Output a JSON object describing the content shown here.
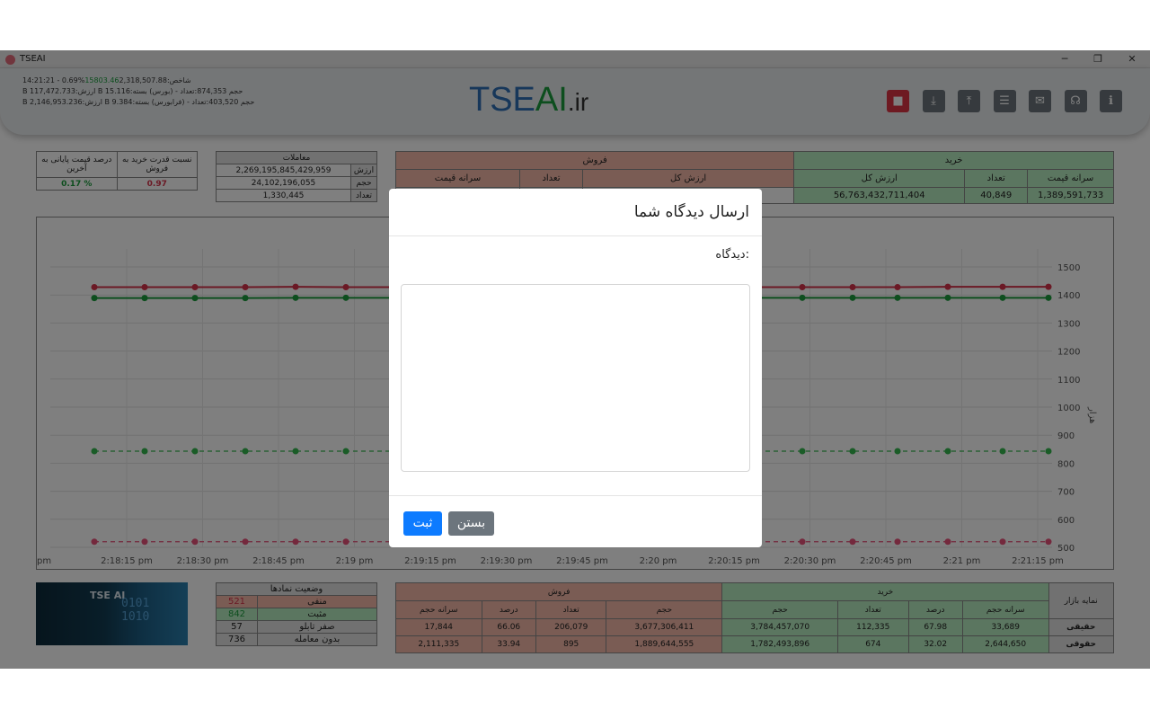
{
  "window": {
    "title": "TSEAI",
    "minimize": "─",
    "restore": "❐",
    "close": "✕"
  },
  "ticker": {
    "line1_time": "14:21:21 - 0.69%",
    "line1_green": "15803.46",
    "line1_rest": "2,318,507.88:شاخص",
    "line2": "B 117,472.733:ارزش B 15.116:حجم 874,353:تعداد - (بورس) بسته",
    "line3": "B 2,146,953.236:ارزش B 9.384:حجم 403,520:تعداد - (فرابورس) بسته"
  },
  "logo": {
    "main": "TSE",
    "ai": "AI",
    "ext": ".ir"
  },
  "toolbar": [
    {
      "name": "stop-button",
      "icon": "stop-icon",
      "glyph": "■"
    },
    {
      "name": "download-button",
      "icon": "download-icon",
      "glyph": "⤓"
    },
    {
      "name": "upload-button",
      "icon": "upload-icon",
      "glyph": "⤒"
    },
    {
      "name": "settings-button",
      "icon": "sliders-icon",
      "glyph": "☰"
    },
    {
      "name": "mail-button",
      "icon": "mail-icon",
      "glyph": "✉"
    },
    {
      "name": "support-button",
      "icon": "headset-icon",
      "glyph": "☊"
    },
    {
      "name": "info-button",
      "icon": "info-icon",
      "glyph": "ℹ"
    }
  ],
  "ratio": {
    "col1_header": "درصد قیمت پایانی به آخرین",
    "col2_header": "نسبت قدرت خرید به فروش",
    "col1_value": "0.17 %",
    "col2_value": "0.97"
  },
  "trades": {
    "title": "معاملات",
    "rows": [
      {
        "label": "ارزش",
        "value": "2,269,195,845,429,959"
      },
      {
        "label": "حجم",
        "value": "24,102,196,055"
      },
      {
        "label": "تعداد",
        "value": "1,330,445"
      }
    ]
  },
  "sell_top": {
    "title": "فروش",
    "headers": [
      "ارزش کل",
      "تعداد",
      "سرانه قیمت"
    ]
  },
  "buy_top": {
    "title": "خرید",
    "headers": [
      "ارزش کل",
      "تعداد",
      "سرانه قیمت"
    ],
    "values": [
      "56,763,432,711,404",
      "40,849",
      "1,389,591,733"
    ]
  },
  "chart_data": {
    "type": "line",
    "x": [
      "2:18:15 pm",
      "2:18:30 pm",
      "2:18:45 pm",
      "2:19 pm",
      "2:19:15 pm",
      "2:19:30 pm",
      "2:19:45 pm",
      "2:20 pm",
      "2:20:15 pm",
      "2:20:30 pm",
      "2:20:45 pm",
      "2:21 pm",
      "2:21:15 pm"
    ],
    "x_left_partial": "pm",
    "ylabel": "هزار",
    "ylim": [
      500,
      1500
    ],
    "yticks": [
      "1500",
      "1400",
      "1300",
      "1200",
      "1100",
      "1000",
      "900",
      "800",
      "700",
      "600",
      "500"
    ],
    "grid": true,
    "series": [
      {
        "color": "#d6334a",
        "dashed": false,
        "values": [
          1428,
          1428,
          1428,
          1428,
          1429,
          1428,
          1428,
          1428,
          1428,
          1428,
          1429,
          1429,
          1429,
          1430
        ]
      },
      {
        "color": "#1a9c3c",
        "dashed": false,
        "values": [
          1389,
          1389,
          1389,
          1389,
          1390,
          1390,
          1390,
          1390,
          1390,
          1390,
          1390,
          1390,
          1390,
          1390
        ]
      },
      {
        "color": "#35b84f",
        "dashed": true,
        "values": [
          843,
          843,
          843,
          843,
          843,
          843,
          843,
          843,
          843,
          843,
          843,
          843,
          843,
          843
        ]
      },
      {
        "color": "#e8527a",
        "dashed": true,
        "values": [
          520,
          520,
          520,
          520,
          520,
          520,
          520,
          520,
          520,
          520,
          520,
          520,
          520,
          520
        ]
      }
    ]
  },
  "thumbnail": {
    "text": "TSE AI"
  },
  "symbols": {
    "title": "وضعیت نمادها",
    "rows": [
      {
        "count": "521",
        "label": "منفی",
        "tone": "red"
      },
      {
        "count": "842",
        "label": "مثبت",
        "tone": "green"
      },
      {
        "count": "57",
        "label": "صفر تابلو",
        "tone": "gray"
      },
      {
        "count": "736",
        "label": "بدون معامله",
        "tone": "gray"
      }
    ]
  },
  "market": {
    "sell_title": "فروش",
    "buy_title": "خرید",
    "index_header": "نمایه بازار",
    "sell_headers": [
      "حجم",
      "تعداد",
      "درصد",
      "سرانه حجم"
    ],
    "buy_headers": [
      "حجم",
      "تعداد",
      "درصد",
      "سرانه حجم"
    ],
    "rows": [
      {
        "label": "حقیقی",
        "sell": [
          "3,677,306,411",
          "206,079",
          "66.06",
          "17,844"
        ],
        "buy": [
          "3,784,457,070",
          "112,335",
          "67.98",
          "33,689"
        ]
      },
      {
        "label": "حقوقی",
        "sell": [
          "1,889,644,555",
          "895",
          "33.94",
          "2,111,335"
        ],
        "buy": [
          "1,782,493,896",
          "674",
          "32.02",
          "2,644,650"
        ]
      }
    ]
  },
  "modal": {
    "title": "ارسال دیدگاه شما",
    "label": "دیدگاه:",
    "textarea_value": "",
    "submit": "ثبت",
    "close": "بستن"
  }
}
